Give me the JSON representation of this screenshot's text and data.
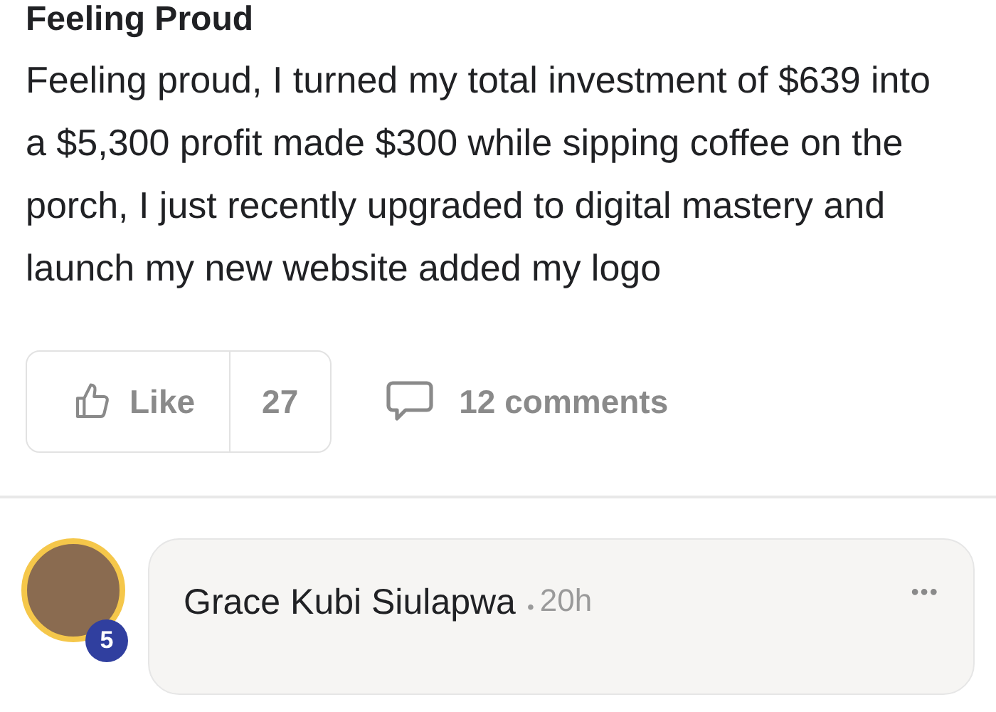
{
  "post": {
    "title": "Feeling Proud",
    "body": "Feeling proud, I turned my total investment of $639 into a $5,300 profit made $300 while sipping coffee on the porch, I just recently upgraded to digital mastery and launch my new website added my logo",
    "like_label": "Like",
    "like_count": "27",
    "comments_label": "12 comments"
  },
  "comment": {
    "author": "Grace Kubi Siulapwa",
    "separator": "•",
    "time": "20h",
    "level_badge": "5",
    "more": "•••"
  }
}
